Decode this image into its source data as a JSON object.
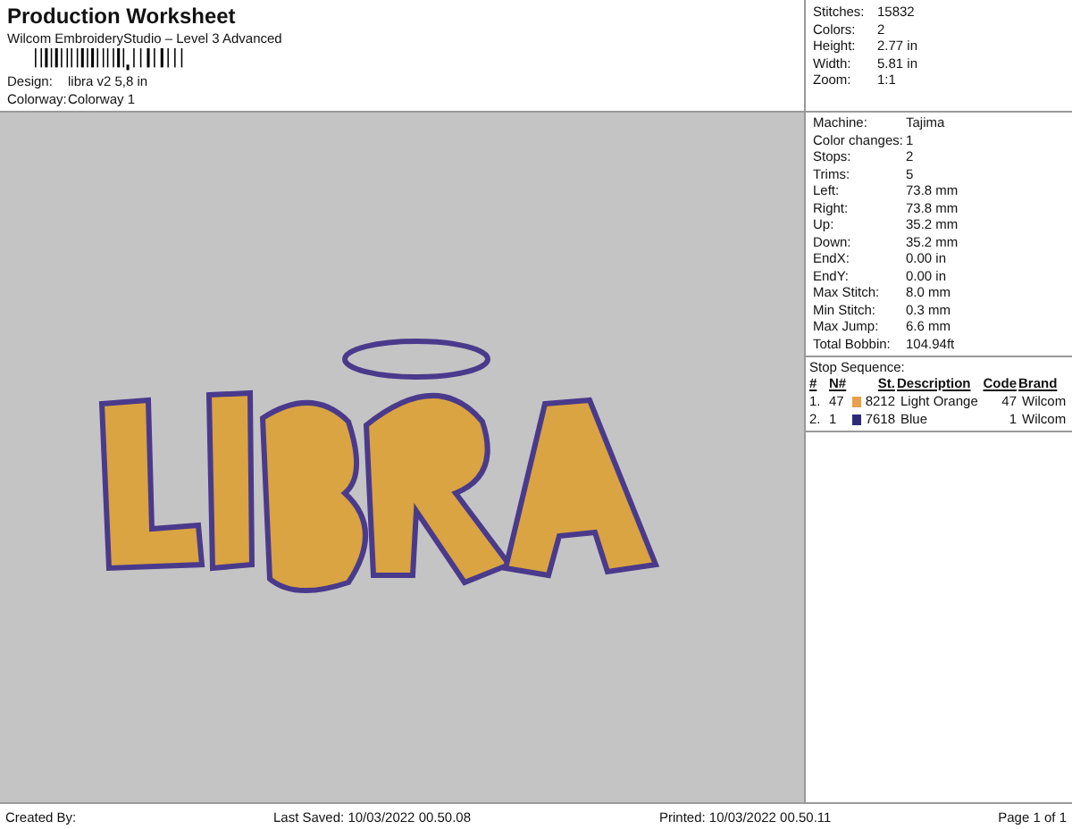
{
  "header": {
    "title": "Production Worksheet",
    "subtitle": "Wilcom EmbroideryStudio – Level 3 Advanced",
    "fields": [
      {
        "label": "Design:",
        "value": "libra v2 5,8 in"
      },
      {
        "label": "Colorway:",
        "value": "Colorway 1"
      }
    ]
  },
  "summary": [
    {
      "label": "Stitches:",
      "value": "15832"
    },
    {
      "label": "Colors:",
      "value": "2"
    },
    {
      "label": "Height:",
      "value": "2.77 in"
    },
    {
      "label": "Width:",
      "value": "5.81 in"
    },
    {
      "label": "Zoom:",
      "value": "1:1"
    }
  ],
  "details": [
    {
      "label": "Machine:",
      "value": "Tajima"
    },
    {
      "label": "Color changes:",
      "value": "1"
    },
    {
      "label": "Stops:",
      "value": "2"
    },
    {
      "label": "Trims:",
      "value": "5"
    },
    {
      "label": "Left:",
      "value": "73.8 mm"
    },
    {
      "label": "Right:",
      "value": "73.8 mm"
    },
    {
      "label": "Up:",
      "value": "35.2 mm"
    },
    {
      "label": "Down:",
      "value": "35.2 mm"
    },
    {
      "label": "EndX:",
      "value": "0.00 in"
    },
    {
      "label": "EndY:",
      "value": "0.00 in"
    },
    {
      "label": "Max Stitch:",
      "value": "8.0 mm"
    },
    {
      "label": "Min Stitch:",
      "value": "0.3 mm"
    },
    {
      "label": "Max Jump:",
      "value": "6.6 mm"
    },
    {
      "label": "Total Bobbin:",
      "value": "104.94ft"
    }
  ],
  "stop_sequence": {
    "title": "Stop Sequence:",
    "columns": [
      "#",
      "N#",
      "St.",
      "Description",
      "Code",
      "Brand"
    ],
    "rows": [
      {
        "index": "1.",
        "needle": "47",
        "color": "#e8a04a",
        "stitch": "8212",
        "description": "Light Orange",
        "code": "47",
        "brand": "Wilcom"
      },
      {
        "index": "2.",
        "needle": "1",
        "color": "#2e2a7a",
        "stitch": "7618",
        "description": "Blue",
        "code": "1",
        "brand": "Wilcom"
      }
    ]
  },
  "footer": {
    "created_by": "Created By:",
    "last_saved": "Last Saved: 10/03/2022 00.50.08",
    "printed": "Printed: 10/03/2022 00.50.11",
    "page": "Page 1 of 1"
  }
}
